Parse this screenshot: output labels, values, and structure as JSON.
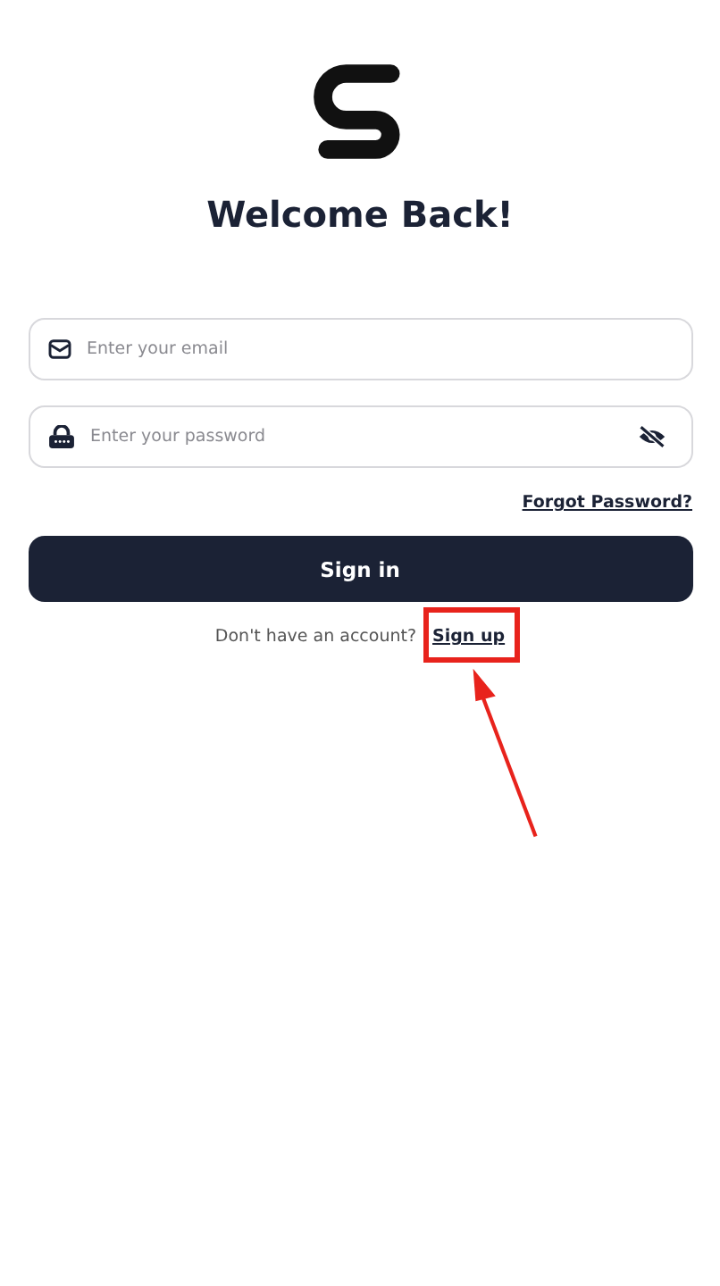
{
  "title": "Welcome Back!",
  "fields": [
    {
      "kind": "email",
      "placeholder": "Enter your email"
    },
    {
      "kind": "password",
      "placeholder": "Enter your password"
    }
  ],
  "forgot_link": "Forgot Password?",
  "submit_button": "Sign in",
  "signup_prompt": {
    "text": "Don't have an account?",
    "link": "Sign up"
  }
}
